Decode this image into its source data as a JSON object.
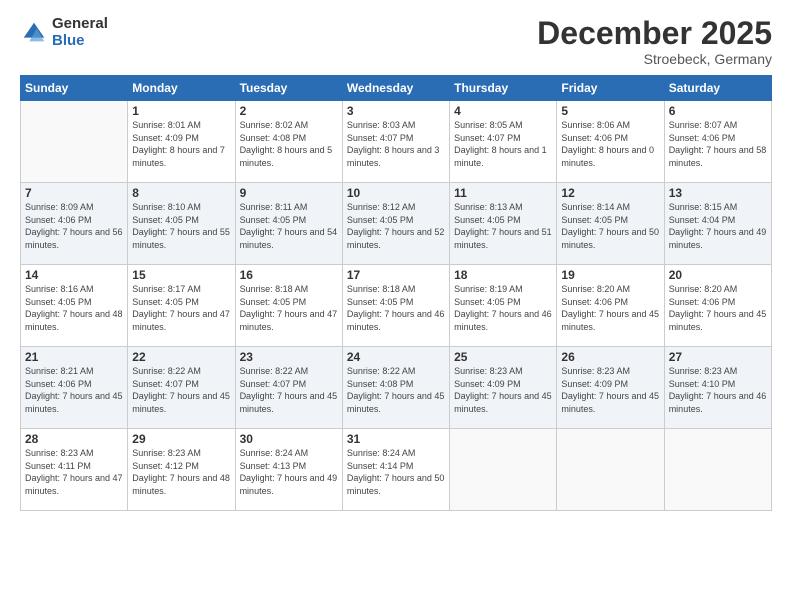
{
  "logo": {
    "general": "General",
    "blue": "Blue"
  },
  "title": "December 2025",
  "subtitle": "Stroebeck, Germany",
  "weekdays": [
    "Sunday",
    "Monday",
    "Tuesday",
    "Wednesday",
    "Thursday",
    "Friday",
    "Saturday"
  ],
  "weeks": [
    [
      {
        "day": "",
        "sunrise": "",
        "sunset": "",
        "daylight": ""
      },
      {
        "day": "1",
        "sunrise": "Sunrise: 8:01 AM",
        "sunset": "Sunset: 4:09 PM",
        "daylight": "Daylight: 8 hours and 7 minutes."
      },
      {
        "day": "2",
        "sunrise": "Sunrise: 8:02 AM",
        "sunset": "Sunset: 4:08 PM",
        "daylight": "Daylight: 8 hours and 5 minutes."
      },
      {
        "day": "3",
        "sunrise": "Sunrise: 8:03 AM",
        "sunset": "Sunset: 4:07 PM",
        "daylight": "Daylight: 8 hours and 3 minutes."
      },
      {
        "day": "4",
        "sunrise": "Sunrise: 8:05 AM",
        "sunset": "Sunset: 4:07 PM",
        "daylight": "Daylight: 8 hours and 1 minute."
      },
      {
        "day": "5",
        "sunrise": "Sunrise: 8:06 AM",
        "sunset": "Sunset: 4:06 PM",
        "daylight": "Daylight: 8 hours and 0 minutes."
      },
      {
        "day": "6",
        "sunrise": "Sunrise: 8:07 AM",
        "sunset": "Sunset: 4:06 PM",
        "daylight": "Daylight: 7 hours and 58 minutes."
      }
    ],
    [
      {
        "day": "7",
        "sunrise": "Sunrise: 8:09 AM",
        "sunset": "Sunset: 4:06 PM",
        "daylight": "Daylight: 7 hours and 56 minutes."
      },
      {
        "day": "8",
        "sunrise": "Sunrise: 8:10 AM",
        "sunset": "Sunset: 4:05 PM",
        "daylight": "Daylight: 7 hours and 55 minutes."
      },
      {
        "day": "9",
        "sunrise": "Sunrise: 8:11 AM",
        "sunset": "Sunset: 4:05 PM",
        "daylight": "Daylight: 7 hours and 54 minutes."
      },
      {
        "day": "10",
        "sunrise": "Sunrise: 8:12 AM",
        "sunset": "Sunset: 4:05 PM",
        "daylight": "Daylight: 7 hours and 52 minutes."
      },
      {
        "day": "11",
        "sunrise": "Sunrise: 8:13 AM",
        "sunset": "Sunset: 4:05 PM",
        "daylight": "Daylight: 7 hours and 51 minutes."
      },
      {
        "day": "12",
        "sunrise": "Sunrise: 8:14 AM",
        "sunset": "Sunset: 4:05 PM",
        "daylight": "Daylight: 7 hours and 50 minutes."
      },
      {
        "day": "13",
        "sunrise": "Sunrise: 8:15 AM",
        "sunset": "Sunset: 4:04 PM",
        "daylight": "Daylight: 7 hours and 49 minutes."
      }
    ],
    [
      {
        "day": "14",
        "sunrise": "Sunrise: 8:16 AM",
        "sunset": "Sunset: 4:05 PM",
        "daylight": "Daylight: 7 hours and 48 minutes."
      },
      {
        "day": "15",
        "sunrise": "Sunrise: 8:17 AM",
        "sunset": "Sunset: 4:05 PM",
        "daylight": "Daylight: 7 hours and 47 minutes."
      },
      {
        "day": "16",
        "sunrise": "Sunrise: 8:18 AM",
        "sunset": "Sunset: 4:05 PM",
        "daylight": "Daylight: 7 hours and 47 minutes."
      },
      {
        "day": "17",
        "sunrise": "Sunrise: 8:18 AM",
        "sunset": "Sunset: 4:05 PM",
        "daylight": "Daylight: 7 hours and 46 minutes."
      },
      {
        "day": "18",
        "sunrise": "Sunrise: 8:19 AM",
        "sunset": "Sunset: 4:05 PM",
        "daylight": "Daylight: 7 hours and 46 minutes."
      },
      {
        "day": "19",
        "sunrise": "Sunrise: 8:20 AM",
        "sunset": "Sunset: 4:06 PM",
        "daylight": "Daylight: 7 hours and 45 minutes."
      },
      {
        "day": "20",
        "sunrise": "Sunrise: 8:20 AM",
        "sunset": "Sunset: 4:06 PM",
        "daylight": "Daylight: 7 hours and 45 minutes."
      }
    ],
    [
      {
        "day": "21",
        "sunrise": "Sunrise: 8:21 AM",
        "sunset": "Sunset: 4:06 PM",
        "daylight": "Daylight: 7 hours and 45 minutes."
      },
      {
        "day": "22",
        "sunrise": "Sunrise: 8:22 AM",
        "sunset": "Sunset: 4:07 PM",
        "daylight": "Daylight: 7 hours and 45 minutes."
      },
      {
        "day": "23",
        "sunrise": "Sunrise: 8:22 AM",
        "sunset": "Sunset: 4:07 PM",
        "daylight": "Daylight: 7 hours and 45 minutes."
      },
      {
        "day": "24",
        "sunrise": "Sunrise: 8:22 AM",
        "sunset": "Sunset: 4:08 PM",
        "daylight": "Daylight: 7 hours and 45 minutes."
      },
      {
        "day": "25",
        "sunrise": "Sunrise: 8:23 AM",
        "sunset": "Sunset: 4:09 PM",
        "daylight": "Daylight: 7 hours and 45 minutes."
      },
      {
        "day": "26",
        "sunrise": "Sunrise: 8:23 AM",
        "sunset": "Sunset: 4:09 PM",
        "daylight": "Daylight: 7 hours and 45 minutes."
      },
      {
        "day": "27",
        "sunrise": "Sunrise: 8:23 AM",
        "sunset": "Sunset: 4:10 PM",
        "daylight": "Daylight: 7 hours and 46 minutes."
      }
    ],
    [
      {
        "day": "28",
        "sunrise": "Sunrise: 8:23 AM",
        "sunset": "Sunset: 4:11 PM",
        "daylight": "Daylight: 7 hours and 47 minutes."
      },
      {
        "day": "29",
        "sunrise": "Sunrise: 8:23 AM",
        "sunset": "Sunset: 4:12 PM",
        "daylight": "Daylight: 7 hours and 48 minutes."
      },
      {
        "day": "30",
        "sunrise": "Sunrise: 8:24 AM",
        "sunset": "Sunset: 4:13 PM",
        "daylight": "Daylight: 7 hours and 49 minutes."
      },
      {
        "day": "31",
        "sunrise": "Sunrise: 8:24 AM",
        "sunset": "Sunset: 4:14 PM",
        "daylight": "Daylight: 7 hours and 50 minutes."
      },
      {
        "day": "",
        "sunrise": "",
        "sunset": "",
        "daylight": ""
      },
      {
        "day": "",
        "sunrise": "",
        "sunset": "",
        "daylight": ""
      },
      {
        "day": "",
        "sunrise": "",
        "sunset": "",
        "daylight": ""
      }
    ]
  ]
}
